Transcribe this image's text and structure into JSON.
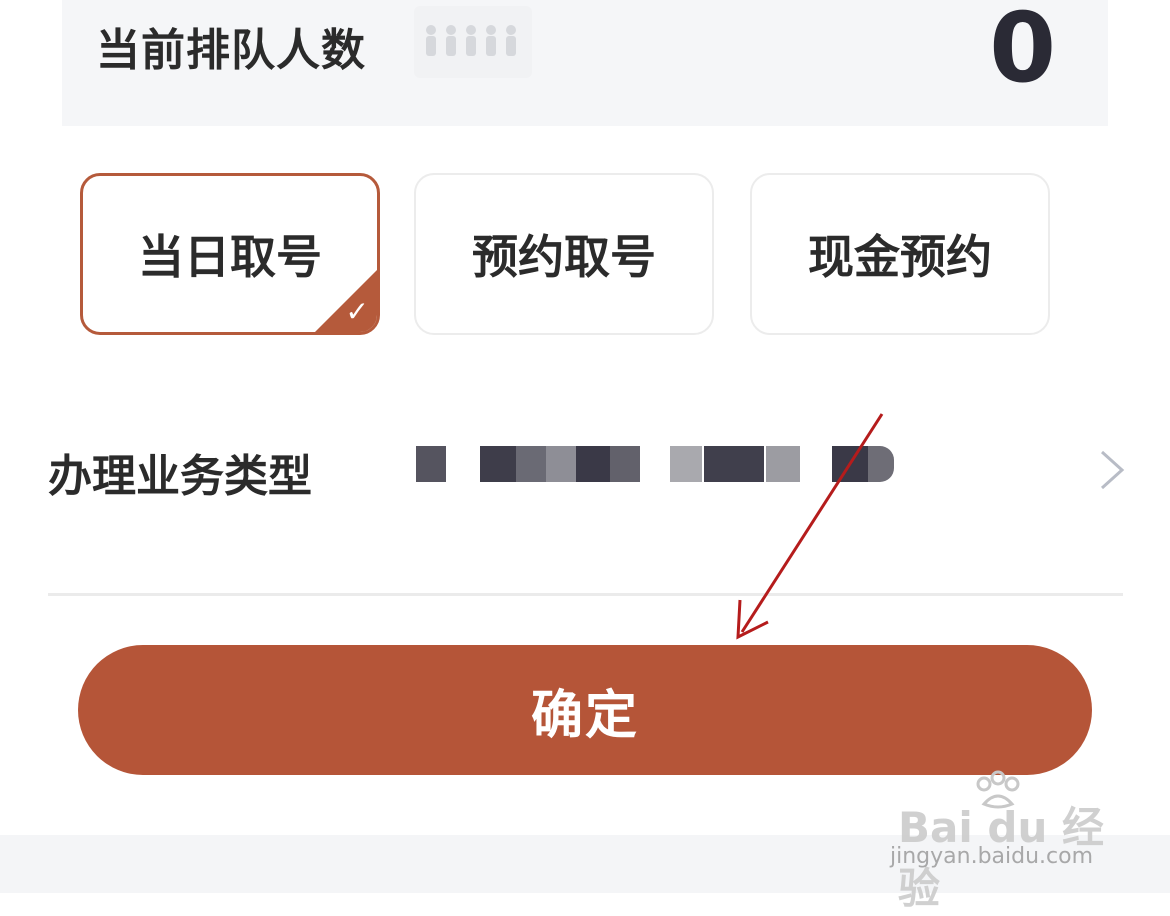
{
  "queue": {
    "label": "当前排队人数",
    "count": "0",
    "people_icon": "people-group-icon"
  },
  "options": [
    {
      "label": "当日取号",
      "selected": true
    },
    {
      "label": "预约取号",
      "selected": false
    },
    {
      "label": "现金预约",
      "selected": false
    }
  ],
  "business_type": {
    "label": "办理业务类型",
    "value_redacted": true,
    "chevron_icon": "chevron-right-icon"
  },
  "confirm": {
    "label": "确定"
  },
  "watermark": {
    "brand": "Bai du 经验",
    "url": "jingyan.baidu.com"
  },
  "colors": {
    "accent": "#b55538",
    "card_bg": "#f5f6f8",
    "annotation_arrow": "#b51c1c"
  }
}
